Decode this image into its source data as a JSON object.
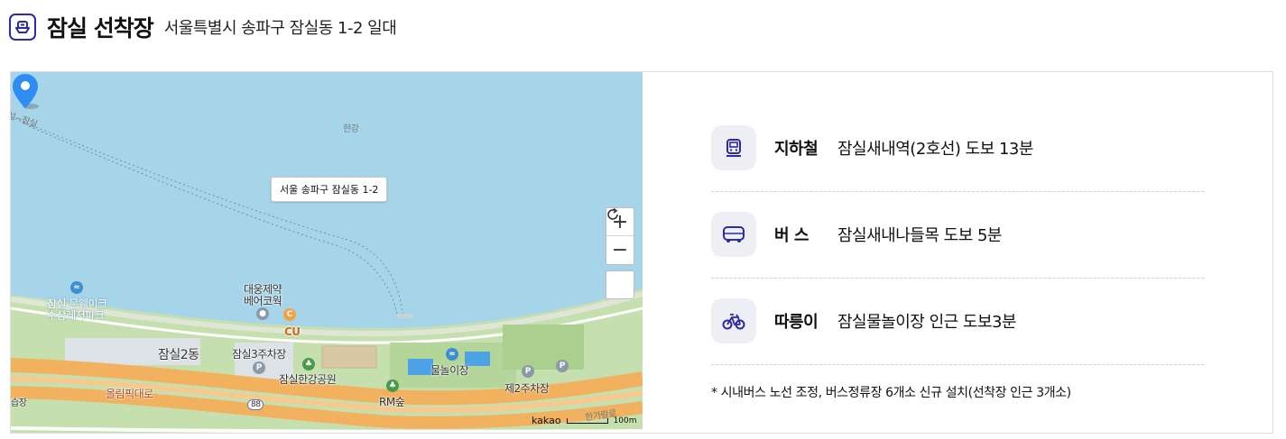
{
  "header": {
    "icon": "ferry-icon",
    "title": "잠실 선착장",
    "address": "서울특별시 송파구 잠실동 1-2 일대"
  },
  "map": {
    "tooltip": "서울 송파구 잠실동 1-2",
    "labels": {
      "river": "한강",
      "line": "섬~잠실",
      "pharma": "대웅제약",
      "cove": "베어코웍",
      "cu": "CU",
      "munweik": "잠실 문웨이크",
      "waterpark": "수상레저파크",
      "district": "잠실2동",
      "parking3": "잠실3주차장",
      "park": "잠실한강공원",
      "waterplay": "물놀이장",
      "parking2": "제2주차장",
      "olympic": "올림픽대로",
      "rmforest": "RM숲",
      "route88": "88",
      "hangaram": "한가람로",
      "edge": "습장",
      "logo": "kakao",
      "scale": "100m"
    },
    "controls": {
      "zoom_in": "+",
      "zoom_out": "−"
    }
  },
  "transport": [
    {
      "icon": "subway-icon",
      "label": "지하철",
      "value": "잠실새내역(2호선) 도보 13분"
    },
    {
      "icon": "bus-icon",
      "label": "버 스",
      "value": "잠실새내나들목 도보 5분"
    },
    {
      "icon": "bicycle-icon",
      "label": "따릉이",
      "value": "잠실물놀이장 인근 도보3분"
    }
  ],
  "note": "* 시내버스 노선 조정, 버스정류장 6개소 신규 설치(선착장 인근 3개소)",
  "colors": {
    "accent": "#2b2aa8",
    "river": "#a6d5ea",
    "park": "#c6dfae",
    "road": "#f2b15f",
    "pin": "#2f8df2"
  }
}
